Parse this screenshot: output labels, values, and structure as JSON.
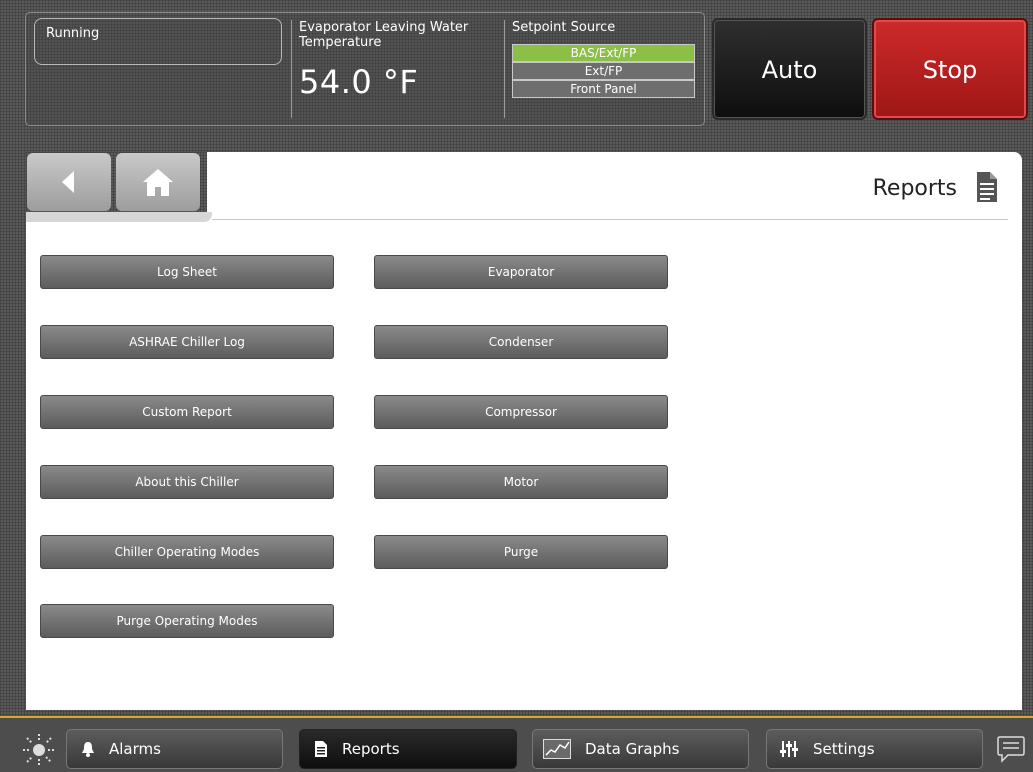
{
  "header": {
    "status": "Running",
    "evap_label": "Evaporator Leaving Water Temperature",
    "evap_value": "54.0 °F",
    "setpoint_title": "Setpoint Source",
    "setpoint_options": [
      "BAS/Ext/FP",
      "Ext/FP",
      "Front Panel"
    ],
    "setpoint_selected": "BAS/Ext/FP",
    "auto_label": "Auto",
    "stop_label": "Stop"
  },
  "page": {
    "title": "Reports"
  },
  "reports": {
    "left": [
      "Log Sheet",
      "ASHRAE Chiller Log",
      "Custom Report",
      "About this Chiller",
      "Chiller Operating Modes",
      "Purge Operating Modes"
    ],
    "right": [
      "Evaporator",
      "Condenser",
      "Compressor",
      "Motor",
      "Purge"
    ]
  },
  "bottom_nav": {
    "alarms": "Alarms",
    "reports": "Reports",
    "data_graphs": "Data Graphs",
    "settings": "Settings"
  },
  "colors": {
    "setpoint_selected": "#8bbf46",
    "stop": "#b51f1f",
    "accent_line": "#d7a929"
  },
  "icons": [
    "back-arrow-icon",
    "home-icon",
    "document-icon",
    "brightness-icon",
    "bell-icon",
    "graph-icon",
    "sliders-icon",
    "chat-icon"
  ]
}
